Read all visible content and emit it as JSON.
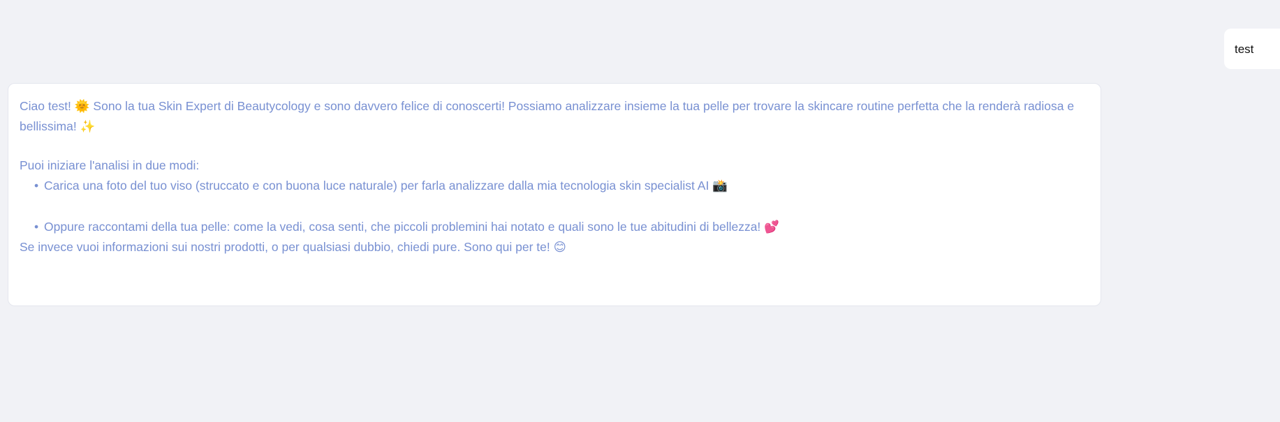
{
  "user_message": {
    "text": "test"
  },
  "bot_message": {
    "intro_text": "Ciao test! 🌞 Sono la tua Skin Expert di Beautycology e sono davvero felice di conoscerti! Possiamo analizzare insieme la tua pelle per trovare la skincare routine perfetta che la renderà radiosa e bellissima! ✨",
    "options_heading": "Puoi iniziare l'analisi in due modi:",
    "options": [
      "Carica una foto del tuo viso (struccato e con buona luce naturale) per farla analizzare dalla mia tecnologia skin specialist AI 📸",
      "Oppure raccontami della tua pelle: come la vedi, cosa senti, che piccoli problemini hai notato e quali sono le tue abitudini di bellezza! 💕"
    ],
    "closing_text": "Se invece vuoi informazioni sui nostri prodotti, o per qualsiasi dubbio, chiedi pure. Sono qui per te! 😊"
  },
  "colors": {
    "background": "#f1f2f6",
    "bot_text": "#7890d2",
    "bubble": "#ffffff"
  }
}
